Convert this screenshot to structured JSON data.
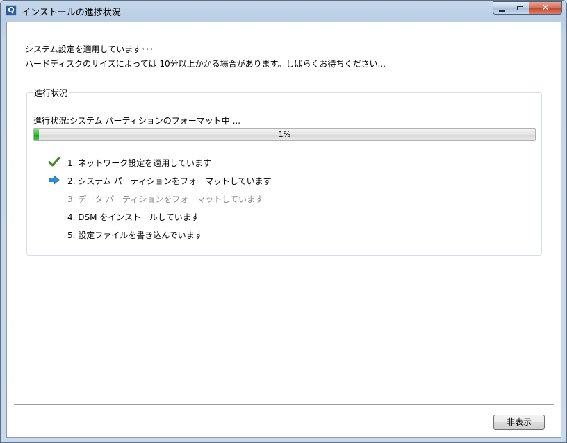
{
  "window": {
    "title": "インストールの進捗状況",
    "app_icon_glyph": "Q"
  },
  "caption_buttons": {
    "close_glyph": "✕"
  },
  "message": {
    "line1": "システム設定を適用しています･･･",
    "line2": "ハードディスクのサイズによっては 10分以上かかる場合があります。しばらくお待ちください..."
  },
  "progress_group": {
    "title": "進行状況",
    "status_text": "進行状況:システム パーティションのフォーマット中 ...",
    "percent_value": 1,
    "percent_label": "1%"
  },
  "steps": [
    {
      "label": "1. ネットワーク設定を適用しています",
      "state": "done",
      "icon": "check-icon"
    },
    {
      "label": "2. システム パーティションをフォーマットしています",
      "state": "active",
      "icon": "arrow-right-icon"
    },
    {
      "label": "3. データ パーティションをフォーマットしています",
      "state": "skipped",
      "icon": ""
    },
    {
      "label": "4. DSM をインストールしています",
      "state": "pending",
      "icon": ""
    },
    {
      "label": "5. 設定ファイルを書き込んでいます",
      "state": "pending",
      "icon": ""
    }
  ],
  "footer": {
    "hide_button_label": "非表示"
  },
  "colors": {
    "progress_fill": "#2fba2f",
    "check": "#3c8a1e",
    "arrow": "#2e8fd6",
    "skipped_text": "#8a8a8a"
  }
}
